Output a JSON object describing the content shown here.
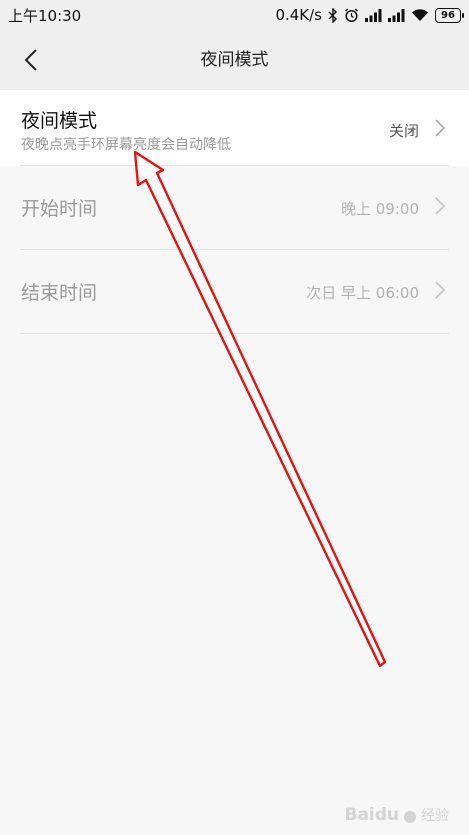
{
  "status_bar": {
    "time": "上午10:30",
    "network_speed": "0.4K/s",
    "icons": [
      "bluetooth-icon",
      "alarm-icon",
      "signal-icon",
      "signal-icon",
      "wifi-icon"
    ],
    "battery": "96"
  },
  "header": {
    "title": "夜间模式",
    "back_icon": "chevron-left-icon"
  },
  "settings": [
    {
      "title": "夜间模式",
      "subtitle": "夜晚点亮手环屏幕亮度会自动降低",
      "value": "关闭"
    },
    {
      "title": "开始时间",
      "value": "晚上 09:00"
    },
    {
      "title": "结束时间",
      "value": "次日 早上 06:00"
    }
  ],
  "annotation": {
    "type": "red-arrow",
    "color": "#e01515"
  },
  "watermark": {
    "text": "Baidu",
    "suffix": "经验"
  }
}
